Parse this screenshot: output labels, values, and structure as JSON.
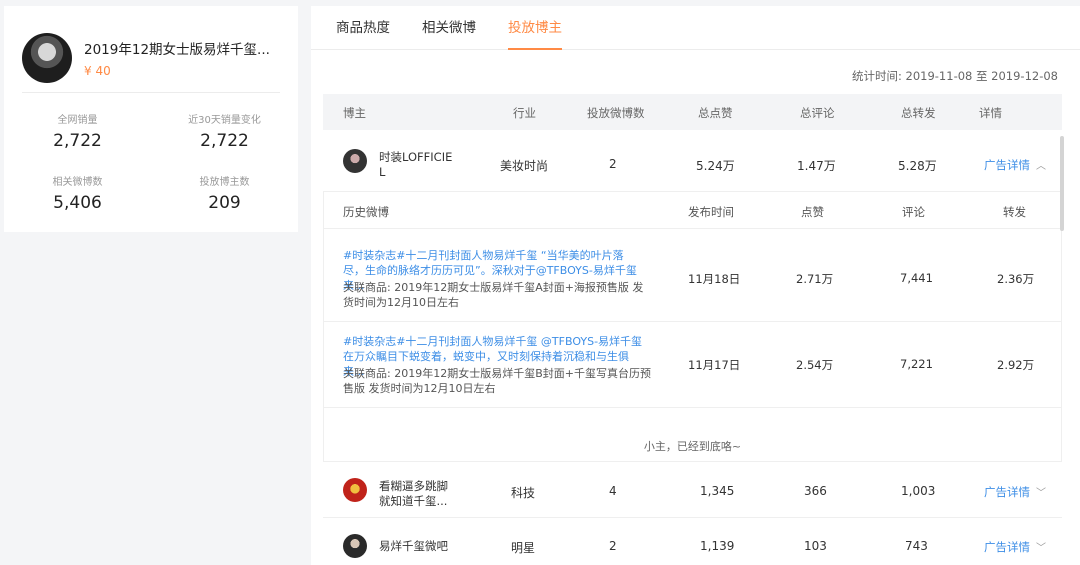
{
  "product": {
    "title": "2019年12期女士版易烊千玺...",
    "price": "¥ 40"
  },
  "stats": [
    {
      "label": "全网销量",
      "value": "2,722"
    },
    {
      "label": "近30天销量变化",
      "value": "2,722"
    },
    {
      "label": "相关微博数",
      "value": "5,406"
    },
    {
      "label": "投放博主数",
      "value": "209"
    }
  ],
  "tabs": [
    {
      "label": "商品热度"
    },
    {
      "label": "相关微博"
    },
    {
      "label": "投放博主"
    }
  ],
  "period": "统计时间: 2019-11-08 至 2019-12-08",
  "table": {
    "headers": [
      "博主",
      "行业",
      "投放微博数",
      "总点赞",
      "总评论",
      "总转发",
      "详情"
    ],
    "rows": [
      {
        "name": "时装LOFFICIE L",
        "industry": "美妆时尚",
        "posts": "2",
        "likes": "5.24万",
        "comments": "1.47万",
        "reposts": "5.28万",
        "detail": "广告详情",
        "expanded": true
      },
      {
        "name": "看糊逼多跳脚 就知道千玺...",
        "industry": "科技",
        "posts": "4",
        "likes": "1,345",
        "comments": "366",
        "reposts": "1,003",
        "detail": "广告详情",
        "expanded": false
      },
      {
        "name": "易烊千玺微吧",
        "industry": "明星",
        "posts": "2",
        "likes": "1,139",
        "comments": "103",
        "reposts": "743",
        "detail": "广告详情",
        "expanded": false
      }
    ]
  },
  "history": {
    "headers": [
      "历史微博",
      "发布时间",
      "点赞",
      "评论",
      "转发"
    ],
    "items": [
      {
        "text": "#时装杂志#十二月刊封面人物易烊千玺 “当华美的叶片落尽，生命的脉络才历历可见”。深秋对于@TFBOYS-易烊千玺 来...",
        "goods": "关联商品:  2019年12期女士版易烊千玺A封面+海报预售版  发货时间为12月10日左右",
        "date": "11月18日",
        "likes": "2.71万",
        "comments": "7,441",
        "reposts": "2.36万"
      },
      {
        "text": "#时装杂志#十二月刊封面人物易烊千玺 @TFBOYS-易烊千玺 在万众瞩目下蜕变着，蜕变中，又时刻保持着沉稳和与生俱来...",
        "goods": "关联商品:  2019年12期女士版易烊千玺B封面+千玺写真台历预售版  发货时间为12月10日左右",
        "date": "11月17日",
        "likes": "2.54万",
        "comments": "7,221",
        "reposts": "2.92万"
      }
    ],
    "end_note": "小主，已经到底咯~"
  },
  "colors": {
    "accent": "#ff8a45",
    "link": "#3d8ee6"
  },
  "icons": [
    "chevron-up-icon",
    "chevron-down-icon"
  ]
}
